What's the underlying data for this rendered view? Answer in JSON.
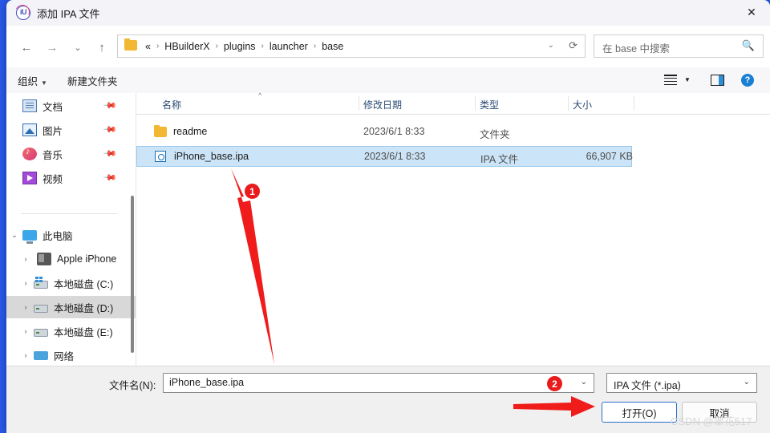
{
  "window": {
    "title": "添加 IPA 文件",
    "app_icon": "hbuilderx-icon",
    "close_label": "✕"
  },
  "nav": {
    "back": "←",
    "forward": "→",
    "recent": "⌄",
    "up": "↑",
    "address_chevron": "⌄",
    "refresh": "⟳",
    "breadcrumbs": [
      "«",
      "HBuilderX",
      "plugins",
      "launcher",
      "base"
    ],
    "separator": "›"
  },
  "search": {
    "placeholder": "在 base 中搜索",
    "icon": "🔍"
  },
  "command_bar": {
    "organize": "组织",
    "organize_caret": "▼",
    "new_folder": "新建文件夹",
    "view_caret": "▼",
    "help": "?"
  },
  "sidebar": {
    "quick_items": [
      {
        "label": "文档",
        "icon": "documents-icon",
        "pin": "📌"
      },
      {
        "label": "图片",
        "icon": "pictures-icon",
        "pin": "📌"
      },
      {
        "label": "音乐",
        "icon": "music-icon",
        "pin": "📌"
      },
      {
        "label": "视频",
        "icon": "videos-icon",
        "pin": "📌"
      }
    ],
    "tree": [
      {
        "label": "此电脑",
        "icon": "this-pc-icon",
        "chevron": "⌄",
        "selected": false
      },
      {
        "label": "Apple iPhone",
        "icon": "iphone-icon",
        "chevron": "›",
        "selected": false
      },
      {
        "label": "本地磁盘 (C:)",
        "icon": "system-drive-icon",
        "chevron": "›",
        "selected": false
      },
      {
        "label": "本地磁盘 (D:)",
        "icon": "drive-icon",
        "chevron": "›",
        "selected": true
      },
      {
        "label": "本地磁盘 (E:)",
        "icon": "drive-icon",
        "chevron": "›",
        "selected": false
      },
      {
        "label": "网络",
        "icon": "network-icon",
        "chevron": "›",
        "selected": false
      }
    ]
  },
  "filelist": {
    "columns": [
      "名称",
      "修改日期",
      "类型",
      "大小"
    ],
    "sort_caret": "^",
    "rows": [
      {
        "name": "readme",
        "date": "2023/6/1 8:33",
        "type": "文件夹",
        "size": "",
        "icon": "folder-icon",
        "selected": false
      },
      {
        "name": "iPhone_base.ipa",
        "date": "2023/6/1 8:33",
        "type": "IPA 文件",
        "size": "66,907 KB",
        "icon": "ipa-file-icon",
        "selected": true
      }
    ]
  },
  "bottom": {
    "filename_label": "文件名(N):",
    "filename_value": "iPhone_base.ipa",
    "filename_caret": "⌄",
    "filetype_value": "IPA 文件 (*.ipa)",
    "filetype_caret": "⌄",
    "open_label": "打开(O)",
    "cancel_label": "取消"
  },
  "annotations": {
    "badge_1": "1",
    "badge_2": "2",
    "arrow_color": "#f01c1c"
  },
  "watermark": "CSDN @翠花517",
  "colors": {
    "desktop": "#2a58e8",
    "selection": "#cce4f7",
    "accent_button": "#2a6fc9",
    "annotation_red": "#e81c1c"
  }
}
